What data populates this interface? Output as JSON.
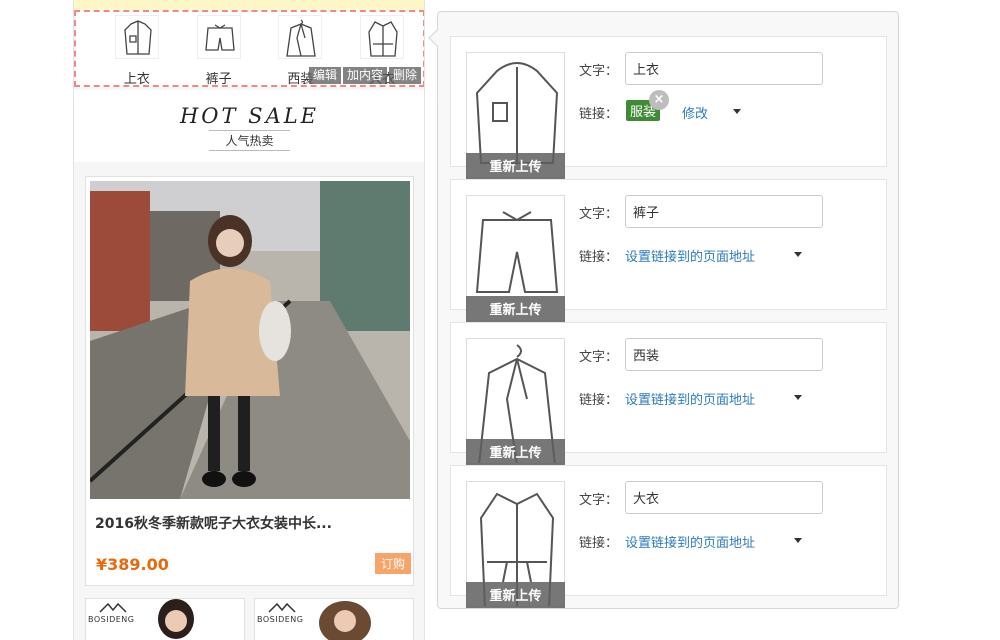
{
  "nav": {
    "items": [
      {
        "label": "上衣",
        "icon": "jacket-icon"
      },
      {
        "label": "裤子",
        "icon": "shorts-icon"
      },
      {
        "label": "西装",
        "icon": "suit-icon"
      },
      {
        "label": "大衣",
        "icon": "coat-icon"
      }
    ],
    "actions": {
      "edit": "编辑",
      "add": "加内容",
      "delete": "删除"
    }
  },
  "hot": {
    "title": "HOT SALE",
    "subtitle": "人气热卖"
  },
  "product": {
    "title": "2016秋冬季新款呢子大衣女装中长...",
    "price": "¥389.00",
    "order": "订购"
  },
  "brand": "BOSIDENG",
  "editor": {
    "text_label": "文字：",
    "link_label": "链接：",
    "reupload": "重新上传",
    "rows": [
      {
        "text": "上衣",
        "tag": "服装",
        "modify": "修改"
      },
      {
        "text": "裤子",
        "link": "设置链接到的页面地址"
      },
      {
        "text": "西装",
        "link": "设置链接到的页面地址"
      },
      {
        "text": "大衣",
        "link": "设置链接到的页面地址"
      }
    ]
  },
  "colors": {
    "accent_link": "#2b7bbd",
    "tag_green": "#3f8a34",
    "price": "#e8690c",
    "order_btn": "#f7a46b",
    "dashed_border": "#f0888a"
  }
}
